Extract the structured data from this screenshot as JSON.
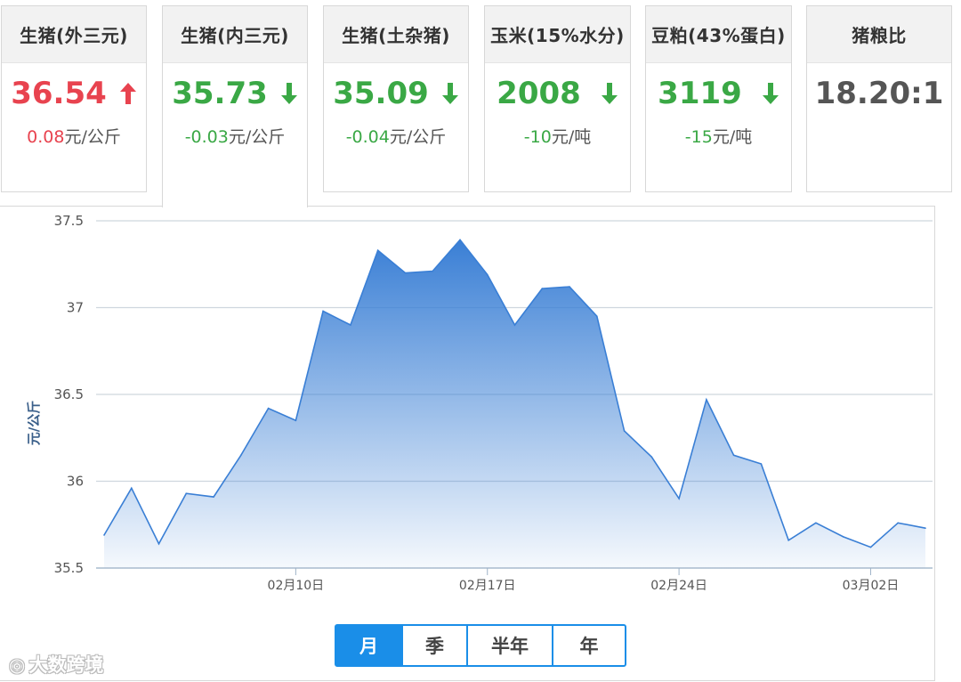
{
  "cards": [
    {
      "title": "生猪(外三元)",
      "price": "36.54",
      "change_value": "0.08",
      "change_unit": "元/公斤",
      "direction": "up"
    },
    {
      "title": "生猪(内三元)",
      "price": "35.73",
      "change_value": "-0.03",
      "change_unit": "元/公斤",
      "direction": "down"
    },
    {
      "title": "生猪(土杂猪)",
      "price": "35.09",
      "change_value": "-0.04",
      "change_unit": "元/公斤",
      "direction": "down"
    },
    {
      "title": "玉米(15%水分)",
      "price": "2008",
      "change_value": "-10",
      "change_unit": "元/吨",
      "direction": "down"
    },
    {
      "title": "豆粕(43%蛋白)",
      "price": "3119",
      "change_value": "-15",
      "change_unit": "元/吨",
      "direction": "down"
    },
    {
      "title": "猪粮比",
      "price": "18.20:1",
      "change_value": "",
      "change_unit": "",
      "direction": "flat"
    }
  ],
  "active_card_index": 1,
  "colors": {
    "up": "#e8434f",
    "down": "#3aa845",
    "accent": "#1a8ee8",
    "line": "#3a7fd5"
  },
  "chart_data": {
    "type": "area",
    "ylabel": "元/公斤",
    "ylim": [
      35.5,
      37.5
    ],
    "yticks": [
      "35.5",
      "36",
      "36.5",
      "37",
      "37.5"
    ],
    "xtick_labels": [
      "02月10日",
      "02月17日",
      "02月24日",
      "03月02日"
    ],
    "grid": true,
    "x": [
      "02/05",
      "02/06",
      "02/07",
      "02/08",
      "02/09",
      "02/10",
      "02/11",
      "02/12",
      "02/13",
      "02/14",
      "02/15",
      "02/16",
      "02/17",
      "02/18",
      "02/19",
      "02/20",
      "02/21",
      "02/22",
      "02/23",
      "02/24",
      "02/25",
      "02/26",
      "02/27",
      "02/28",
      "03/01",
      "03/02",
      "03/03",
      "03/04",
      "03/05"
    ],
    "series": [
      {
        "values": [
          35.69,
          35.96,
          35.64,
          35.93,
          35.91,
          36.15,
          36.42,
          36.35,
          36.98,
          36.9,
          37.33,
          37.2,
          37.21,
          37.39,
          37.19,
          36.9,
          37.11,
          37.12,
          36.95,
          36.29,
          36.14,
          35.9,
          36.47,
          36.15,
          36.1,
          35.66,
          35.76,
          35.68,
          35.62,
          35.76,
          35.73
        ]
      }
    ]
  },
  "periods": [
    {
      "label": "月",
      "selected": true
    },
    {
      "label": "季",
      "selected": false
    },
    {
      "label": "半年",
      "selected": false
    },
    {
      "label": "年",
      "selected": false
    }
  ],
  "watermark": {
    "text": "大数跨境"
  }
}
